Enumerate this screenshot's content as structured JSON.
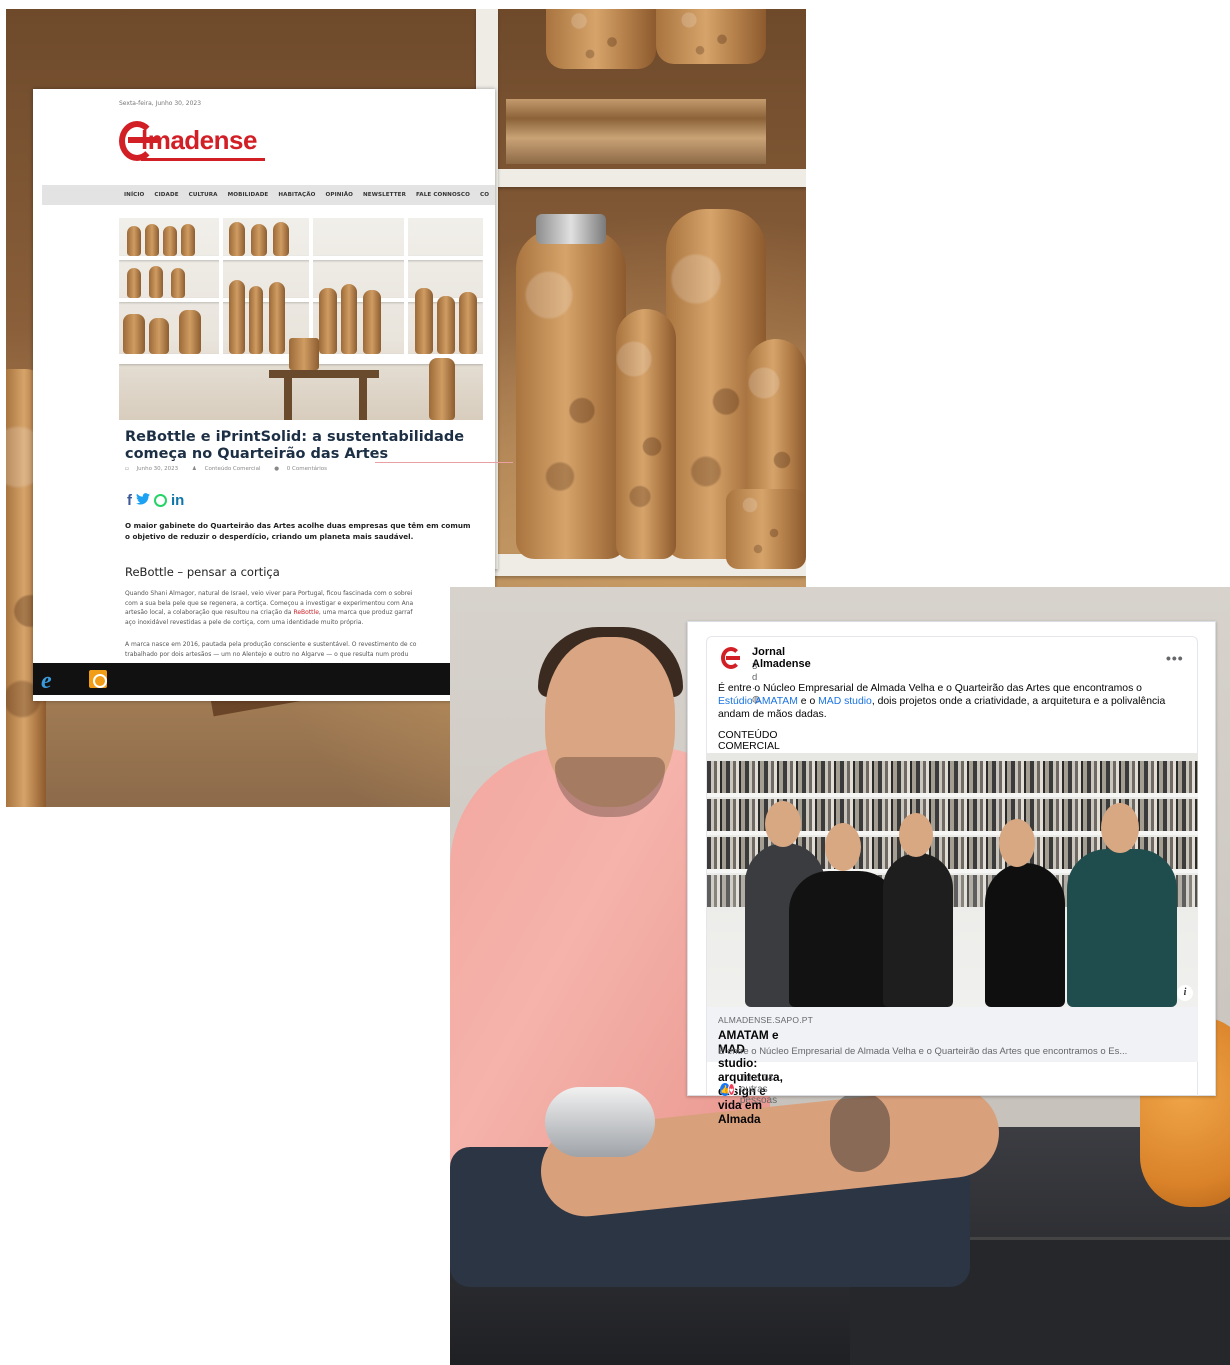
{
  "newspaper": {
    "date": "Sexta-feira, Junho 30, 2023",
    "logo_text": "lmadense",
    "nav": [
      "INÍCIO",
      "CIDADE",
      "CULTURA",
      "MOBILIDADE",
      "HABITAÇÃO",
      "OPINIÃO",
      "NEWSLETTER",
      "FALE CONNOSCO",
      "CO"
    ],
    "article_title": "ReBottle e iPrintSolid: a sustentabilidade começa no Quarteirão das Artes",
    "meta": {
      "date": "Junho 30, 2023",
      "author": "Conteúdo Comercial",
      "comments": "0 Comentários"
    },
    "share_icons": [
      "facebook-icon",
      "twitter-icon",
      "whatsapp-icon",
      "linkedin-icon"
    ],
    "lede": "O maior gabinete do Quarteirão das Artes acolhe duas empresas que têm em comum o objetivo de reduzir o desperdício, criando um planeta mais saudável.",
    "subhead": "ReBottle – pensar a cortiça",
    "paragraph1": {
      "line1": "Quando Shani Almagor, natural de Israel, veio viver para Portugal, ficou fascinada com o sobrei",
      "line2": "com a sua bela pele que se regenera, a cortiça. Começou a investigar e experimentou com Ana",
      "line3_a": "artesão local, a colaboração que resultou na criação da ",
      "line3_link": "ReBottle",
      "line3_b": ", uma marca que produz garraf",
      "line4": "aço inoxidável revestidas a pele de cortiça, com uma identidade muito própria."
    },
    "paragraph2": {
      "line1": "A marca nasce em 2016, pautada pela produção consciente e sustentável. O revestimento de co",
      "line2": "trabalhado por dois artesãos — um no Alentejo e outro no Algarve — o que resulta num produ"
    },
    "taskbar_icons": [
      "internet-explorer-icon",
      "outlook-icon"
    ]
  },
  "facebook_post": {
    "page_name": "Jornal Almadense",
    "time": "3 d · ",
    "globe_icon": "globe-icon",
    "more_label": "•••",
    "text_line1": "É entre o Núcleo Empresarial de Almada Velha e o Quarteirão das Artes que encontramos o",
    "text_link1": "Estúdio AMATAM",
    "text_mid": " e o ",
    "text_link2": "MAD studio",
    "text_line2_rest": ", dois projetos onde a criatividade, a arquitetura e a polivalência",
    "text_line3": "andam de mãos dadas.",
    "tag": "CONTEÚDO COMERCIAL",
    "info_label": "i",
    "link_domain": "ALMADENSE.SAPO.PT",
    "link_title": "AMATAM e MAD studio: arquitetura, design e vida em Almada",
    "link_desc": "É entre o Núcleo Empresarial de Almada Velha e o Quarteirão das Artes que encontramos o Es...",
    "reactions_text": "Tu e 14 outras pessoas",
    "like_glyph": "👍",
    "love_glyph": "♥"
  },
  "colors": {
    "brand_red": "#d21f26",
    "facebook_blue": "#1877f2",
    "link_blue": "#1b74e4",
    "title_navy": "#1c2f44"
  }
}
